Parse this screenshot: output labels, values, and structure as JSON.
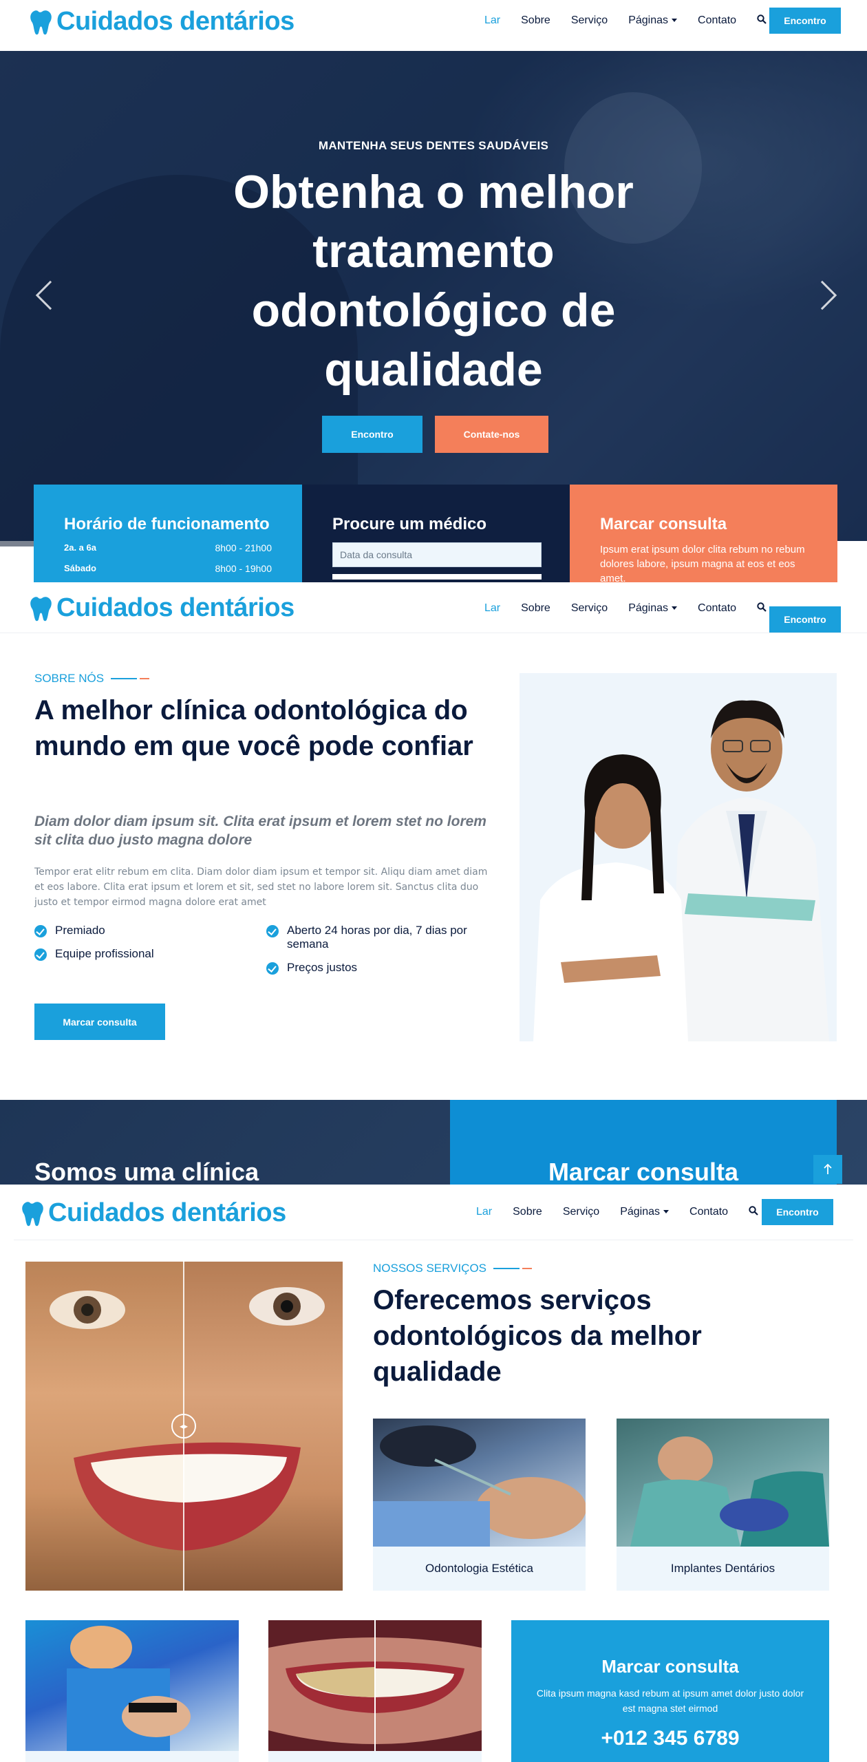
{
  "brand": {
    "name": "Cuidados dentários",
    "accent": "#1aa0dc",
    "secondary": "#f47f5a",
    "dark": "#0a1a3c"
  },
  "nav": {
    "items": [
      {
        "label": "Lar",
        "active": true
      },
      {
        "label": "Sobre"
      },
      {
        "label": "Serviço"
      },
      {
        "label": "Páginas",
        "dropdown": true
      },
      {
        "label": "Contato"
      }
    ],
    "search_icon": "search-icon",
    "cta": "Encontro"
  },
  "hero": {
    "subtitle": "MANTENHA SEUS DENTES SAUDÁVEIS",
    "title": "Obtenha o melhor tratamento odontológico de qualidade",
    "button_primary": "Encontro",
    "button_secondary": "Contate-nos"
  },
  "info_cards": {
    "hours": {
      "title": "Horário de funcionamento",
      "rows": [
        {
          "day": "2a. a 6a",
          "time": "8h00 - 21h00"
        },
        {
          "day": "Sábado",
          "time": "8h00 - 19h00"
        }
      ]
    },
    "doctor": {
      "title": "Procure um médico",
      "date_placeholder": "Data da consulta"
    },
    "appointment": {
      "title": "Marcar consulta",
      "text": "Ipsum erat ipsum dolor clita rebum no rebum dolores labore, ipsum magna at eos et eos amet."
    }
  },
  "about": {
    "kicker": "SOBRE NÓS",
    "title": "A melhor clínica odontológica do mundo em que você pode confiar",
    "lead": "Diam dolor diam ipsum sit. Clita erat ipsum et lorem stet no lorem sit clita duo justo magna dolore",
    "body": "Tempor erat elitr rebum em clita. Diam dolor diam ipsum et tempor sit. Aliqu diam amet diam et eos labore. Clita erat ipsum et lorem et sit, sed stet no labore lorem sit. Sanctus clita duo justo et tempor eirmod magna dolore erat amet",
    "features_left": [
      "Premiado",
      "Equipe profissional"
    ],
    "features_right": [
      "Aberto 24 horas por dia, 7 dias por semana",
      "Preços justos"
    ],
    "button": "Marcar consulta"
  },
  "band": {
    "left_title": "Somos uma clínica",
    "right_title": "Marcar consulta"
  },
  "services": {
    "kicker": "NOSSOS SERVIÇOS",
    "title": "Oferecemos serviços odontológicos da melhor qualidade",
    "items": [
      {
        "label": "Odontologia Estética"
      },
      {
        "label": "Implantes Dentários"
      }
    ],
    "cta_card": {
      "title": "Marcar consulta",
      "text": "Clita ipsum magna kasd rebum at ipsum amet dolor justo dolor est magna stet eirmod",
      "phone": "+012 345 6789"
    }
  }
}
